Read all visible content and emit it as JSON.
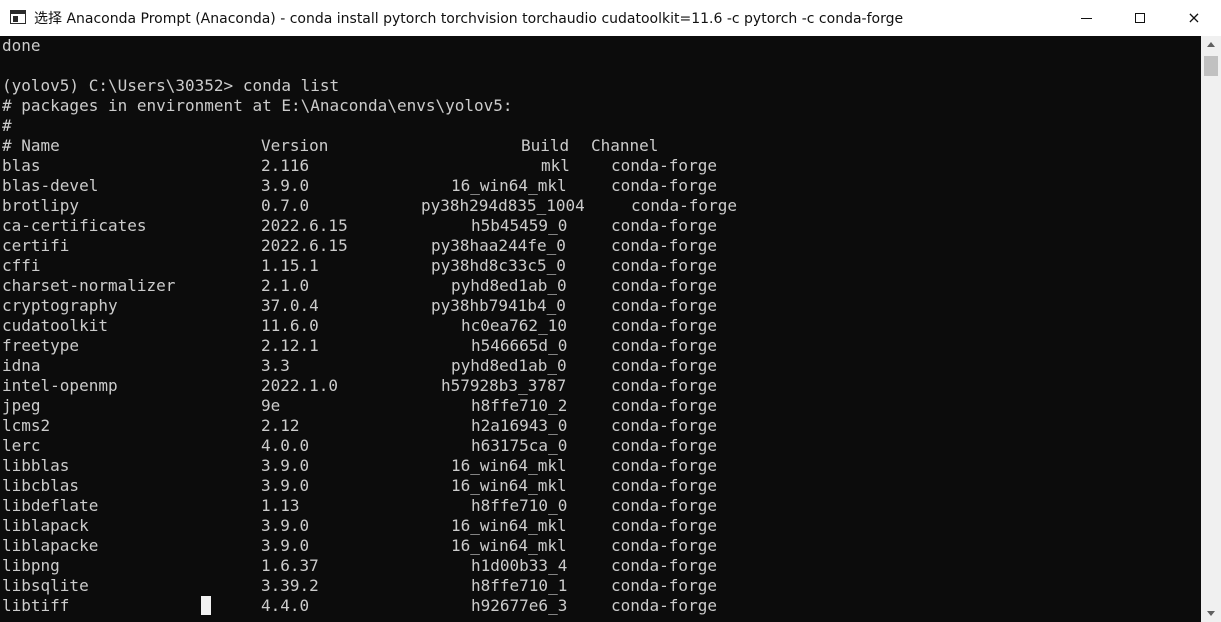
{
  "window": {
    "title": "选择 Anaconda Prompt (Anaconda) - conda  install pytorch torchvision torchaudio cudatoolkit=11.6 -c pytorch -c conda-forge",
    "minimize": "minimize",
    "maximize": "maximize",
    "close": "×"
  },
  "console": {
    "header_lines": [
      "done",
      "",
      "(yolov5) C:\\Users\\30352> conda list",
      "# packages in environment at E:\\Anaconda\\envs\\yolov5:",
      "#"
    ],
    "columns": [
      "# Name",
      "Version",
      "Build",
      "Channel"
    ],
    "packages": [
      {
        "name": "blas",
        "version": "2.116",
        "build": "mkl",
        "channel": "conda-forge"
      },
      {
        "name": "blas-devel",
        "version": "3.9.0",
        "build": "16_win64_mkl",
        "channel": "conda-forge"
      },
      {
        "name": "brotlipy",
        "version": "0.7.0",
        "build": "py38h294d835_1004",
        "channel": "conda-forge"
      },
      {
        "name": "ca-certificates",
        "version": "2022.6.15",
        "build": "h5b45459_0",
        "channel": "conda-forge"
      },
      {
        "name": "certifi",
        "version": "2022.6.15",
        "build": "py38haa244fe_0",
        "channel": "conda-forge"
      },
      {
        "name": "cffi",
        "version": "1.15.1",
        "build": "py38hd8c33c5_0",
        "channel": "conda-forge"
      },
      {
        "name": "charset-normalizer",
        "version": "2.1.0",
        "build": "pyhd8ed1ab_0",
        "channel": "conda-forge"
      },
      {
        "name": "cryptography",
        "version": "37.0.4",
        "build": "py38hb7941b4_0",
        "channel": "conda-forge"
      },
      {
        "name": "cudatoolkit",
        "version": "11.6.0",
        "build": "hc0ea762_10",
        "channel": "conda-forge"
      },
      {
        "name": "freetype",
        "version": "2.12.1",
        "build": "h546665d_0",
        "channel": "conda-forge"
      },
      {
        "name": "idna",
        "version": "3.3",
        "build": "pyhd8ed1ab_0",
        "channel": "conda-forge"
      },
      {
        "name": "intel-openmp",
        "version": "2022.1.0",
        "build": "h57928b3_3787",
        "channel": "conda-forge"
      },
      {
        "name": "jpeg",
        "version": "9e",
        "build": "h8ffe710_2",
        "channel": "conda-forge"
      },
      {
        "name": "lcms2",
        "version": "2.12",
        "build": "h2a16943_0",
        "channel": "conda-forge"
      },
      {
        "name": "lerc",
        "version": "4.0.0",
        "build": "h63175ca_0",
        "channel": "conda-forge"
      },
      {
        "name": "libblas",
        "version": "3.9.0",
        "build": "16_win64_mkl",
        "channel": "conda-forge"
      },
      {
        "name": "libcblas",
        "version": "3.9.0",
        "build": "16_win64_mkl",
        "channel": "conda-forge"
      },
      {
        "name": "libdeflate",
        "version": "1.13",
        "build": "h8ffe710_0",
        "channel": "conda-forge"
      },
      {
        "name": "liblapack",
        "version": "3.9.0",
        "build": "16_win64_mkl",
        "channel": "conda-forge"
      },
      {
        "name": "liblapacke",
        "version": "3.9.0",
        "build": "16_win64_mkl",
        "channel": "conda-forge"
      },
      {
        "name": "libpng",
        "version": "1.6.37",
        "build": "h1d00b33_4",
        "channel": "conda-forge"
      },
      {
        "name": "libsqlite",
        "version": "3.39.2",
        "build": "h8ffe710_1",
        "channel": "conda-forge"
      },
      {
        "name": "libtiff",
        "version": "4.4.0",
        "build": "h92677e6_3",
        "channel": "conda-forge"
      }
    ]
  },
  "colors": {
    "background": "#0c0c0c",
    "text": "#cccccc",
    "titlebar": "#ffffff"
  }
}
